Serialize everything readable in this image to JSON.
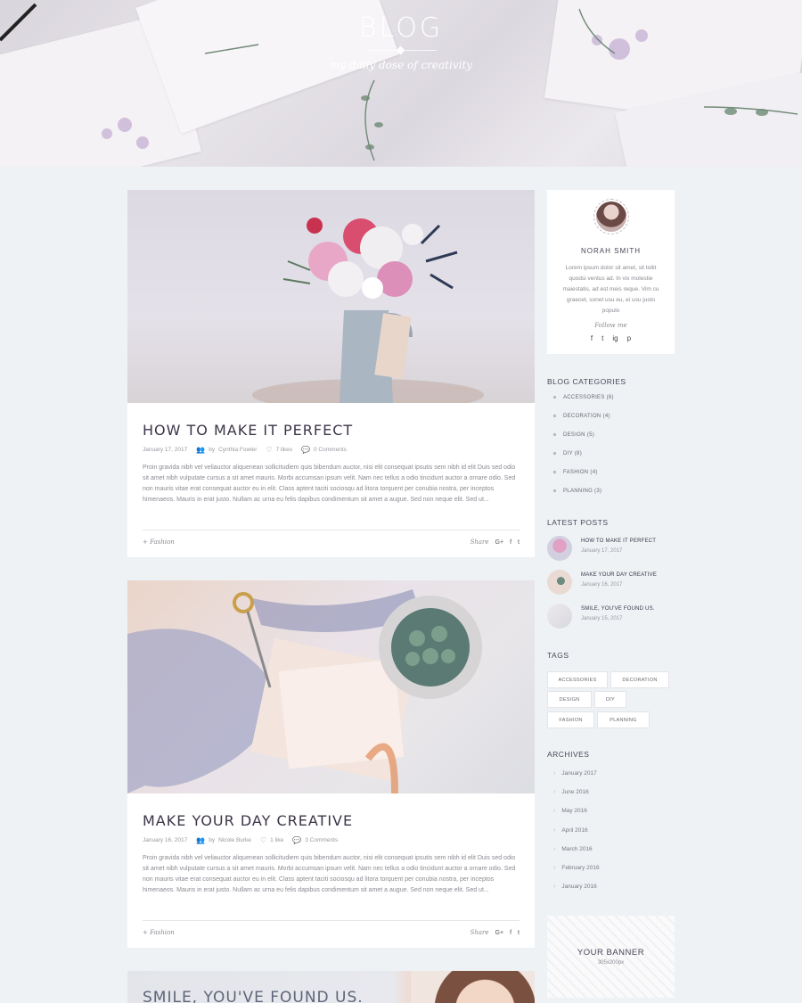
{
  "header": {
    "title": "BLOG",
    "subtitle": "my daily dose of creativity"
  },
  "posts": [
    {
      "title": "HOW TO MAKE IT PERFECT",
      "date": "January 17, 2017",
      "author_prefix": "by",
      "author": "Cynthia Fowler",
      "likes": "7 likes",
      "comments": "0 Comments",
      "excerpt": "Proin gravida nibh vel veliauctor aliquenean sollicitudiem quis bibendum auctor, nisi elit consequat ipsutis sem nibh id elit Duis sed odio sit amet nibh vulputate cursus a sit amet mauris. Morbi accumsan ipsum velit. Nam nec tellus a odio tincidunt auctor a ornare odio. Sed non mauris vitae erat consequat auctor eu in elit. Class aptent taciti sociosqu ad litora torquent per conubia nostra, per inceptos himenaeos. Mauris in erat justo. Nullam ac urna eu felis dapibus condimentum sit amet a augue. Sed non neque elit. Sed ut...",
      "category": "Fashion",
      "share_label": "Share"
    },
    {
      "title": "MAKE YOUR DAY CREATIVE",
      "date": "January 16, 2017",
      "author_prefix": "by",
      "author": "Nicole Burke",
      "likes": "1 like",
      "comments": "3 Comments",
      "excerpt": "Proin gravida nibh vel veliauctor aliquenean sollicitudiem quis bibendum auctor, nisi elit consequat ipsutis sem nibh id elit Duis sed odio sit amet nibh vulputate cursus a sit amet mauris. Morbi accumsan ipsum velit. Nam nec tellus a odio tincidunt auctor a ornare odio. Sed non mauris vitae erat consequat auctor eu in elit. Class aptent taciti sociosqu ad litora torquent per conubia nostra, per inceptos himenaeos. Mauris in erat justo. Nullam ac urna eu felis dapibus condimentum sit amet a augue. Sed non neque elit. Sed ut...",
      "category": "Fashion",
      "share_label": "Share"
    },
    {
      "title": "SMILE, YOU'VE FOUND US."
    }
  ],
  "share_icons": [
    "G+",
    "f",
    "t"
  ],
  "author": {
    "name": "NORAH SMITH",
    "bio": "Lorem ipsum dolor sit amet, sit tollit quodsi ventus ad. In vix molestie maiestatis, ad est meis reque. Vim cu graecet, sonet usu eu, ei usu justo populo",
    "follow_label": "Follow me",
    "social_icons": [
      "f",
      "t",
      "ig",
      "p"
    ]
  },
  "categories_widget": {
    "title": "BLOG CATEGORIES",
    "items": [
      "ACCESSORIES (6)",
      "DECORATION (4)",
      "DESIGN (5)",
      "DIY (8)",
      "FASHION (4)",
      "PLANNING (3)"
    ]
  },
  "latest_widget": {
    "title": "LATEST POSTS",
    "items": [
      {
        "title": "HOW TO MAKE IT PERFECT",
        "date": "January 17, 2017"
      },
      {
        "title": "MAKE YOUR DAY CREATIVE",
        "date": "January 16, 2017"
      },
      {
        "title": "SMILE, YOU'VE FOUND US.",
        "date": "January 15, 2017"
      }
    ]
  },
  "tags_widget": {
    "title": "TAGS",
    "items": [
      "ACCESSORIES",
      "DECORATION",
      "DESIGN",
      "DIY",
      "FASHION",
      "PLANNING"
    ]
  },
  "archives_widget": {
    "title": "ARCHIVES",
    "items": [
      "January 2017",
      "June 2016",
      "May 2016",
      "April 2016",
      "March 2016",
      "February 2016",
      "January 2016"
    ]
  },
  "banner": {
    "title": "YOUR BANNER",
    "size": "305x200px"
  }
}
